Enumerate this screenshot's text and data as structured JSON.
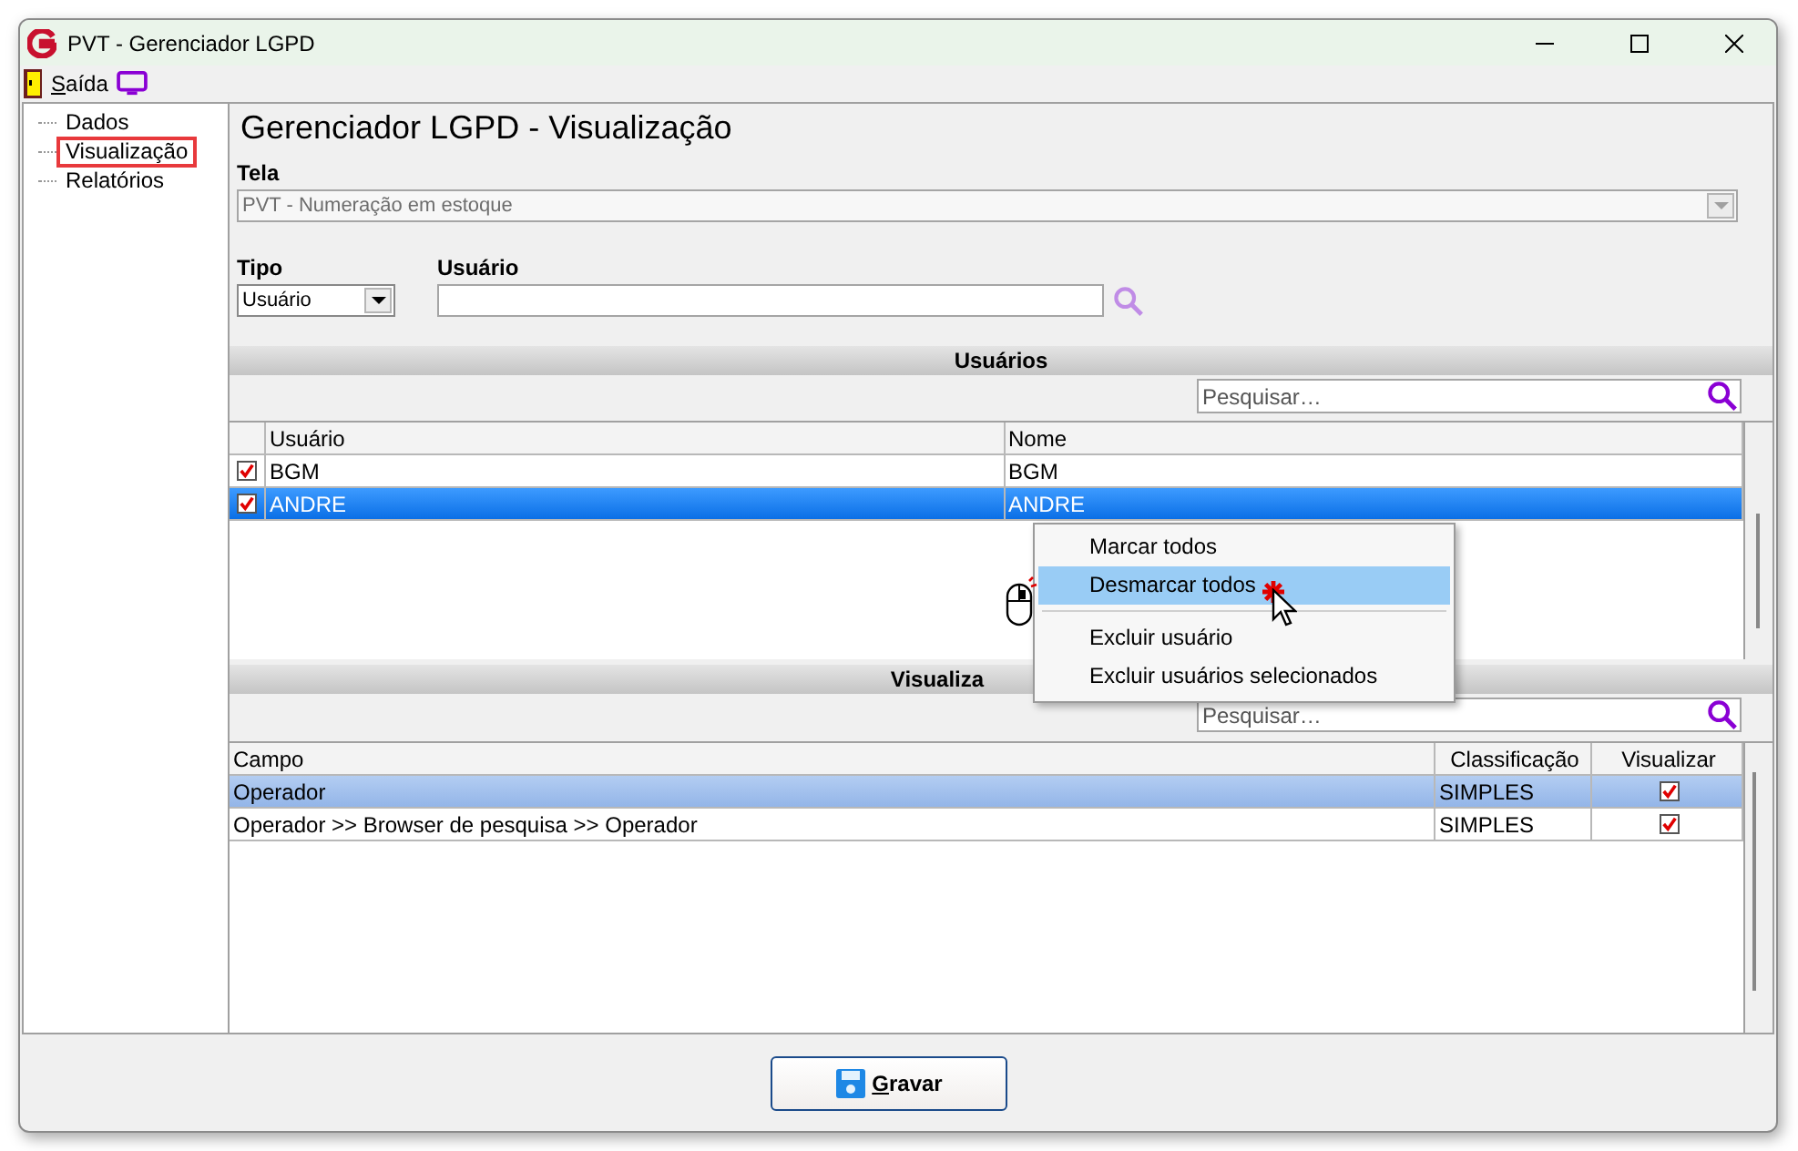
{
  "window": {
    "title": "PVT - Gerenciador LGPD"
  },
  "menu": {
    "exit_label": "Saída"
  },
  "tree": [
    {
      "label": "Dados",
      "selected": false
    },
    {
      "label": "Visualização",
      "selected": true
    },
    {
      "label": "Relatórios",
      "selected": false
    }
  ],
  "heading": "Gerenciador LGPD - Visualização",
  "tela": {
    "label": "Tela",
    "value": "PVT - Numeração em estoque",
    "disabled": true
  },
  "tipo": {
    "label": "Tipo",
    "value": "Usuário"
  },
  "usuario": {
    "label": "Usuário"
  },
  "users_section": {
    "title": "Usuários",
    "search_placeholder": "Pesquisar…",
    "columns": [
      "Usuário",
      "Nome"
    ],
    "rows": [
      {
        "checked": true,
        "selected": false,
        "cells": [
          "BGM",
          "BGM"
        ]
      },
      {
        "checked": true,
        "selected": true,
        "cells": [
          "ANDRE",
          "ANDRE"
        ]
      }
    ]
  },
  "context_menu": {
    "items": [
      {
        "kind": "item",
        "label": "Marcar todos",
        "selected": false
      },
      {
        "kind": "item",
        "label": "Desmarcar todos",
        "selected": true
      },
      {
        "kind": "separator"
      },
      {
        "kind": "item",
        "label": "Excluir usuário",
        "selected": false
      },
      {
        "kind": "item",
        "label": "Excluir usuários selecionados",
        "selected": false
      }
    ]
  },
  "fields_section": {
    "title": "Visualiza",
    "search_placeholder": "Pesquisar…",
    "columns": [
      "Campo",
      "Classificação",
      "Visualizar"
    ],
    "rows": [
      {
        "selected": true,
        "cells": [
          "Operador",
          "SIMPLES"
        ],
        "visualizar": true
      },
      {
        "selected": false,
        "cells": [
          "Operador >> Browser de pesquisa >> Operador",
          "SIMPLES"
        ],
        "visualizar": true
      }
    ]
  },
  "save_button": "Gravar"
}
